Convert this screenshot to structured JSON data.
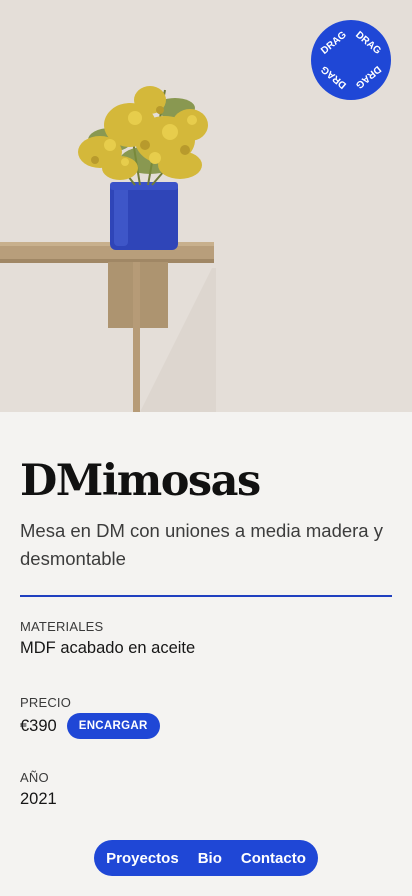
{
  "hero": {
    "badge_text": "DRAG",
    "colors": {
      "badge": "#1f47d6",
      "vase": "#2f45b8",
      "flowers": "#d1b636",
      "table": "#b69b77"
    }
  },
  "product": {
    "title": "DMimosas",
    "description": "Mesa en DM con uniones a media madera y desmontable"
  },
  "fields": {
    "materiales": {
      "label": "MATERIALES",
      "value": "MDF acabado en aceite"
    },
    "precio": {
      "label": "PRECIO",
      "value": "€390",
      "button_label": "ENCARGAR"
    },
    "anio": {
      "label": "AÑO",
      "value": "2021"
    }
  },
  "nav": {
    "items": [
      {
        "label": "Proyectos"
      },
      {
        "label": "Bio"
      },
      {
        "label": "Contacto"
      }
    ]
  },
  "colors": {
    "accent": "#1f47d6",
    "background": "#f4f3f1",
    "divider": "#1f3fbf"
  }
}
